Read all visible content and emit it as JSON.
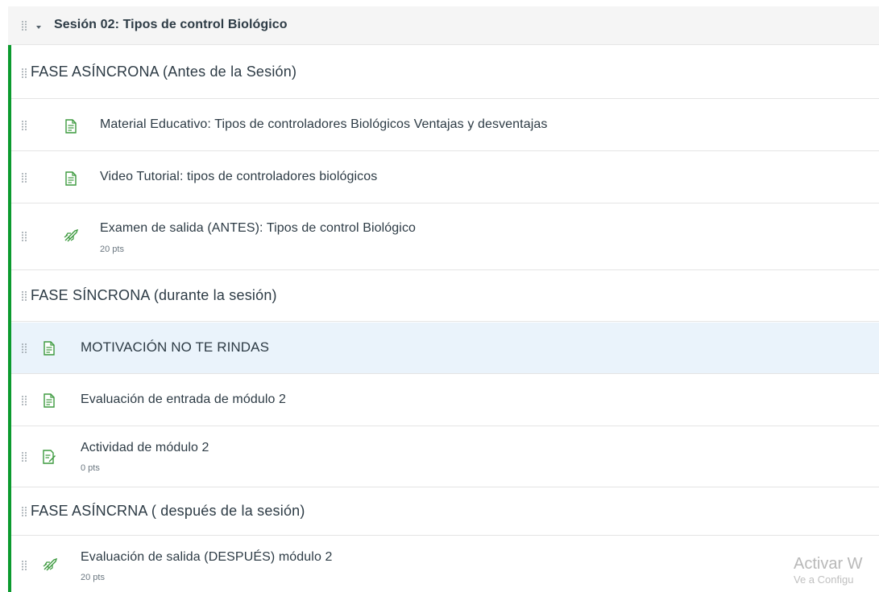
{
  "module": {
    "title": "Sesión 02: Tipos de control Biológico",
    "accent_color": "#0b9a2e"
  },
  "items": [
    {
      "kind": "subheader",
      "title": "FASE ASÍNCRONA (Antes de la Sesión)"
    },
    {
      "kind": "page",
      "icon": "page-icon",
      "title": "Material Educativo: Tipos de controladores Biológicos Ventajas y desventajas"
    },
    {
      "kind": "page",
      "icon": "page-icon",
      "title": "Video Tutorial: tipos de controladores biológicos"
    },
    {
      "kind": "quiz",
      "icon": "quiz-rocket-icon",
      "title": "Examen de salida (ANTES): Tipos de control Biológico",
      "points": "20 pts"
    },
    {
      "kind": "subheader",
      "title": "FASE SÍNCRONA (durante la sesión)"
    },
    {
      "kind": "page",
      "icon": "page-icon",
      "title": "MOTIVACIÓN NO TE RINDAS",
      "highlighted": true
    },
    {
      "kind": "page",
      "icon": "page-icon",
      "title": "Evaluación de entrada de módulo 2"
    },
    {
      "kind": "assignment",
      "icon": "assignment-icon",
      "title": "Actividad de módulo 2",
      "points": "0 pts"
    },
    {
      "kind": "subheader",
      "title": "FASE ASÍNCRNA ( después de la sesión)"
    },
    {
      "kind": "quiz",
      "icon": "quiz-rocket-icon",
      "title": "Evaluación de salida (DESPUÉS) módulo 2",
      "points": "20 pts"
    }
  ],
  "watermark": {
    "title": "Activar W",
    "subtitle": "Ve a Configu"
  }
}
